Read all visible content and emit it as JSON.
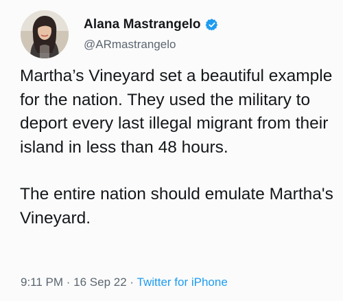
{
  "author": {
    "display_name": "Alana Mastrangelo",
    "handle": "@ARmastrangelo",
    "verified_icon": "verified-badge-icon",
    "avatar_icon": "profile-photo",
    "verified_color": "#1d9bf0"
  },
  "tweet": {
    "paragraph_1": "Martha’s Vineyard set a beautiful example for the nation. They used the military to deport every last illegal migrant from their island in less than 48 hours.",
    "paragraph_2": "The entire nation should emulate Martha's Vineyard."
  },
  "meta": {
    "time": "9:11 PM",
    "separator_1": " · ",
    "date": "16 Sep 22",
    "separator_2": " · ",
    "source": "Twitter for iPhone"
  },
  "colors": {
    "text": "#14171a",
    "secondary": "#5b6670",
    "link": "#1d9bf0"
  }
}
